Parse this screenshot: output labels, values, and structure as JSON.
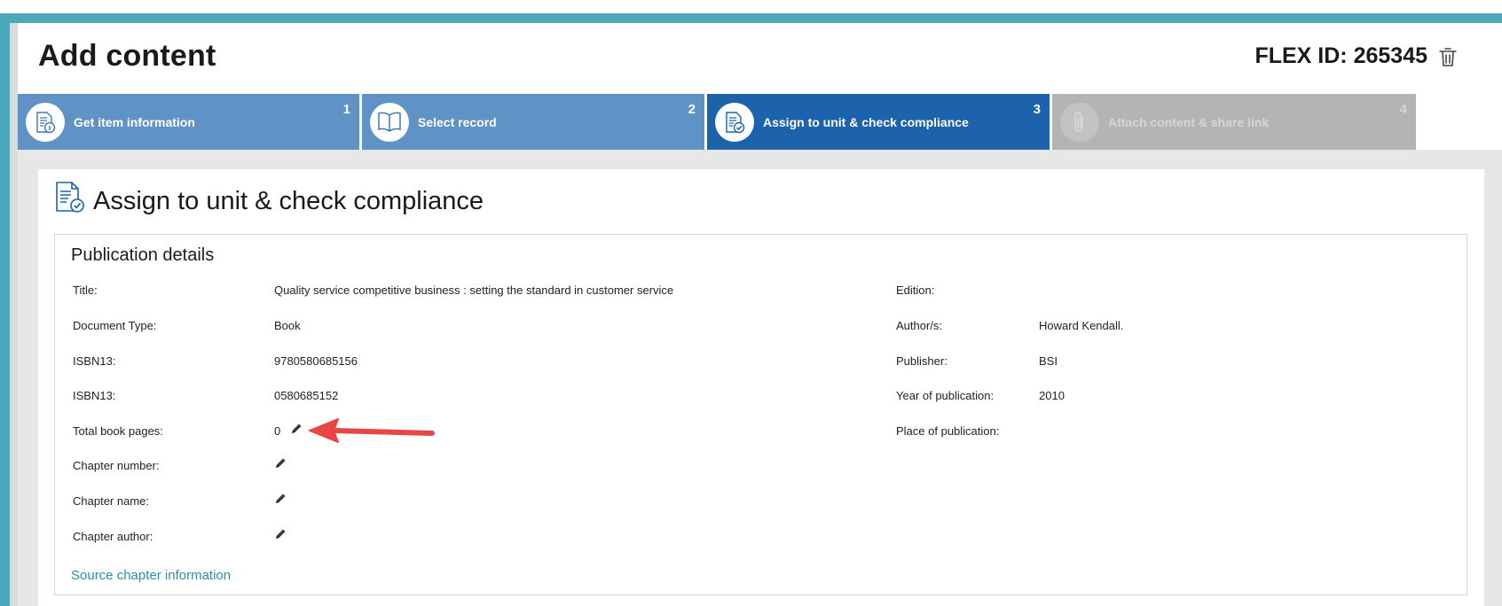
{
  "header": {
    "title": "Add content",
    "flex_id": "FLEX ID: 265345"
  },
  "steps": [
    {
      "number": "1",
      "label": "Get item information",
      "state": "done",
      "icon": "document-info-icon"
    },
    {
      "number": "2",
      "label": "Select record",
      "state": "done",
      "icon": "open-book-icon"
    },
    {
      "number": "3",
      "label": "Assign to unit & check compliance",
      "state": "active",
      "icon": "document-check-icon"
    },
    {
      "number": "4",
      "label": "Attach content & share link",
      "state": "disabled",
      "icon": "paperclip-icon"
    }
  ],
  "section": {
    "title": "Assign to unit & check compliance"
  },
  "publication": {
    "heading": "Publication details",
    "left_fields": [
      {
        "label": "Title:",
        "value": "Quality service competitive business : setting the standard in customer service"
      },
      {
        "label": "Document Type:",
        "value": "Book"
      },
      {
        "label": "ISBN13:",
        "value": "9780580685156"
      },
      {
        "label": "ISBN13:",
        "value": "0580685152"
      },
      {
        "label": "Total book pages:",
        "value": "0"
      },
      {
        "label": "Chapter number:",
        "value": ""
      },
      {
        "label": "Chapter name:",
        "value": ""
      },
      {
        "label": "Chapter author:",
        "value": ""
      }
    ],
    "right_fields": [
      {
        "label": "Edition:",
        "value": ""
      },
      {
        "label": "Author/s:",
        "value": "Howard Kendall."
      },
      {
        "label": "Publisher:",
        "value": "BSI"
      },
      {
        "label": "Year of publication:",
        "value": "2010"
      },
      {
        "label": "Place of publication:",
        "value": ""
      }
    ],
    "source_link": "Source chapter information"
  },
  "colors": {
    "frame": "#4ba8bb",
    "step_done": "#5f93c6",
    "step_active": "#1c63ac",
    "step_disabled": "#b4b4b4",
    "link": "#2b8fa8",
    "annotation_arrow": "#e84545"
  }
}
